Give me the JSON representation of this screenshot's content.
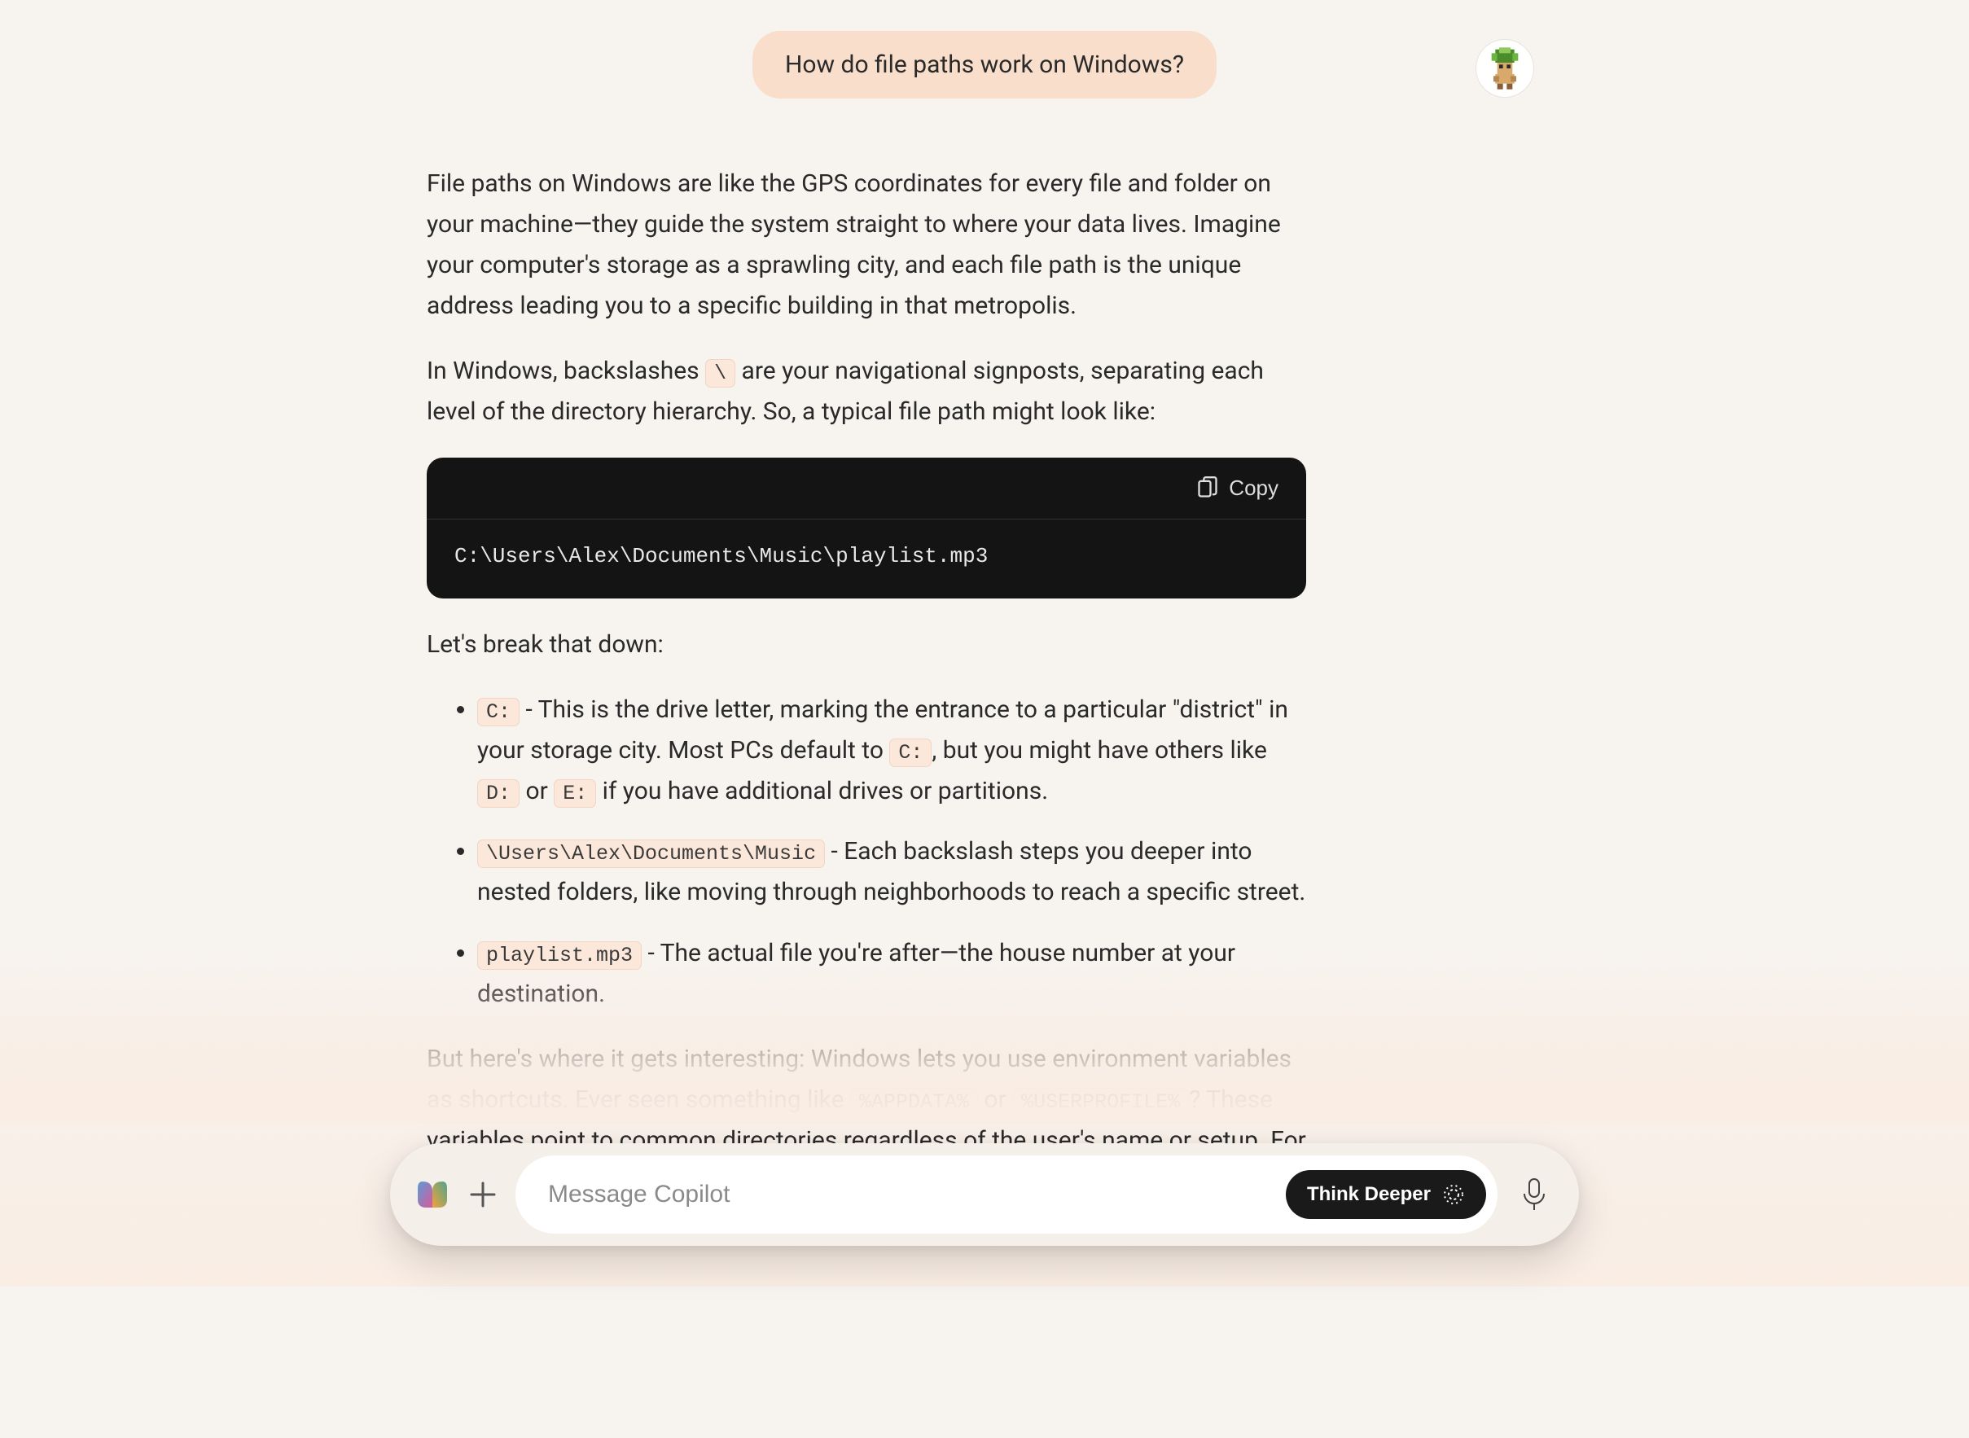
{
  "user_message": "How do file paths work on Windows?",
  "assistant": {
    "para1": "File paths on Windows are like the GPS coordinates for every file and folder on your machine—they guide the system straight to where your data lives. Imagine your computer's storage as a sprawling city, and each file path is the unique address leading you to a specific building in that metropolis.",
    "para2_a": "In Windows, backslashes ",
    "para2_code": "\\",
    "para2_b": " are your navigational signposts, separating each level of the directory hierarchy. So, a typical file path might look like:",
    "codeblock": {
      "copy_label": "Copy",
      "content": "C:\\Users\\Alex\\Documents\\Music\\playlist.mp3"
    },
    "para3": "Let's break that down:",
    "bullets": [
      {
        "code1": "C:",
        "text1": " - This is the drive letter, marking the entrance to a particular \"district\" in your storage city. Most PCs default to ",
        "code2": "C:",
        "text2": ", but you might have others like ",
        "code3": "D:",
        "text3": " or ",
        "code4": "E:",
        "text4": " if you have additional drives or partitions."
      },
      {
        "code1": "\\Users\\Alex\\Documents\\Music",
        "text1": " - Each backslash steps you deeper into nested folders, like moving through neighborhoods to reach a specific street."
      },
      {
        "code1": "playlist.mp3",
        "text1": " - The actual file you're after—the house number at your destination."
      }
    ],
    "para4_a": "But here's where it gets interesting: Windows lets you use environment variables as shortcuts. Ever seen something like ",
    "para4_code1": "%APPDATA%",
    "para4_b": " or ",
    "para4_code2": "%USERPROFILE%",
    "para4_c": "? These variables point to common directories regardless of the user's name or setup. For example,"
  },
  "input_bar": {
    "placeholder": "Message Copilot",
    "think_deeper": "Think Deeper"
  }
}
